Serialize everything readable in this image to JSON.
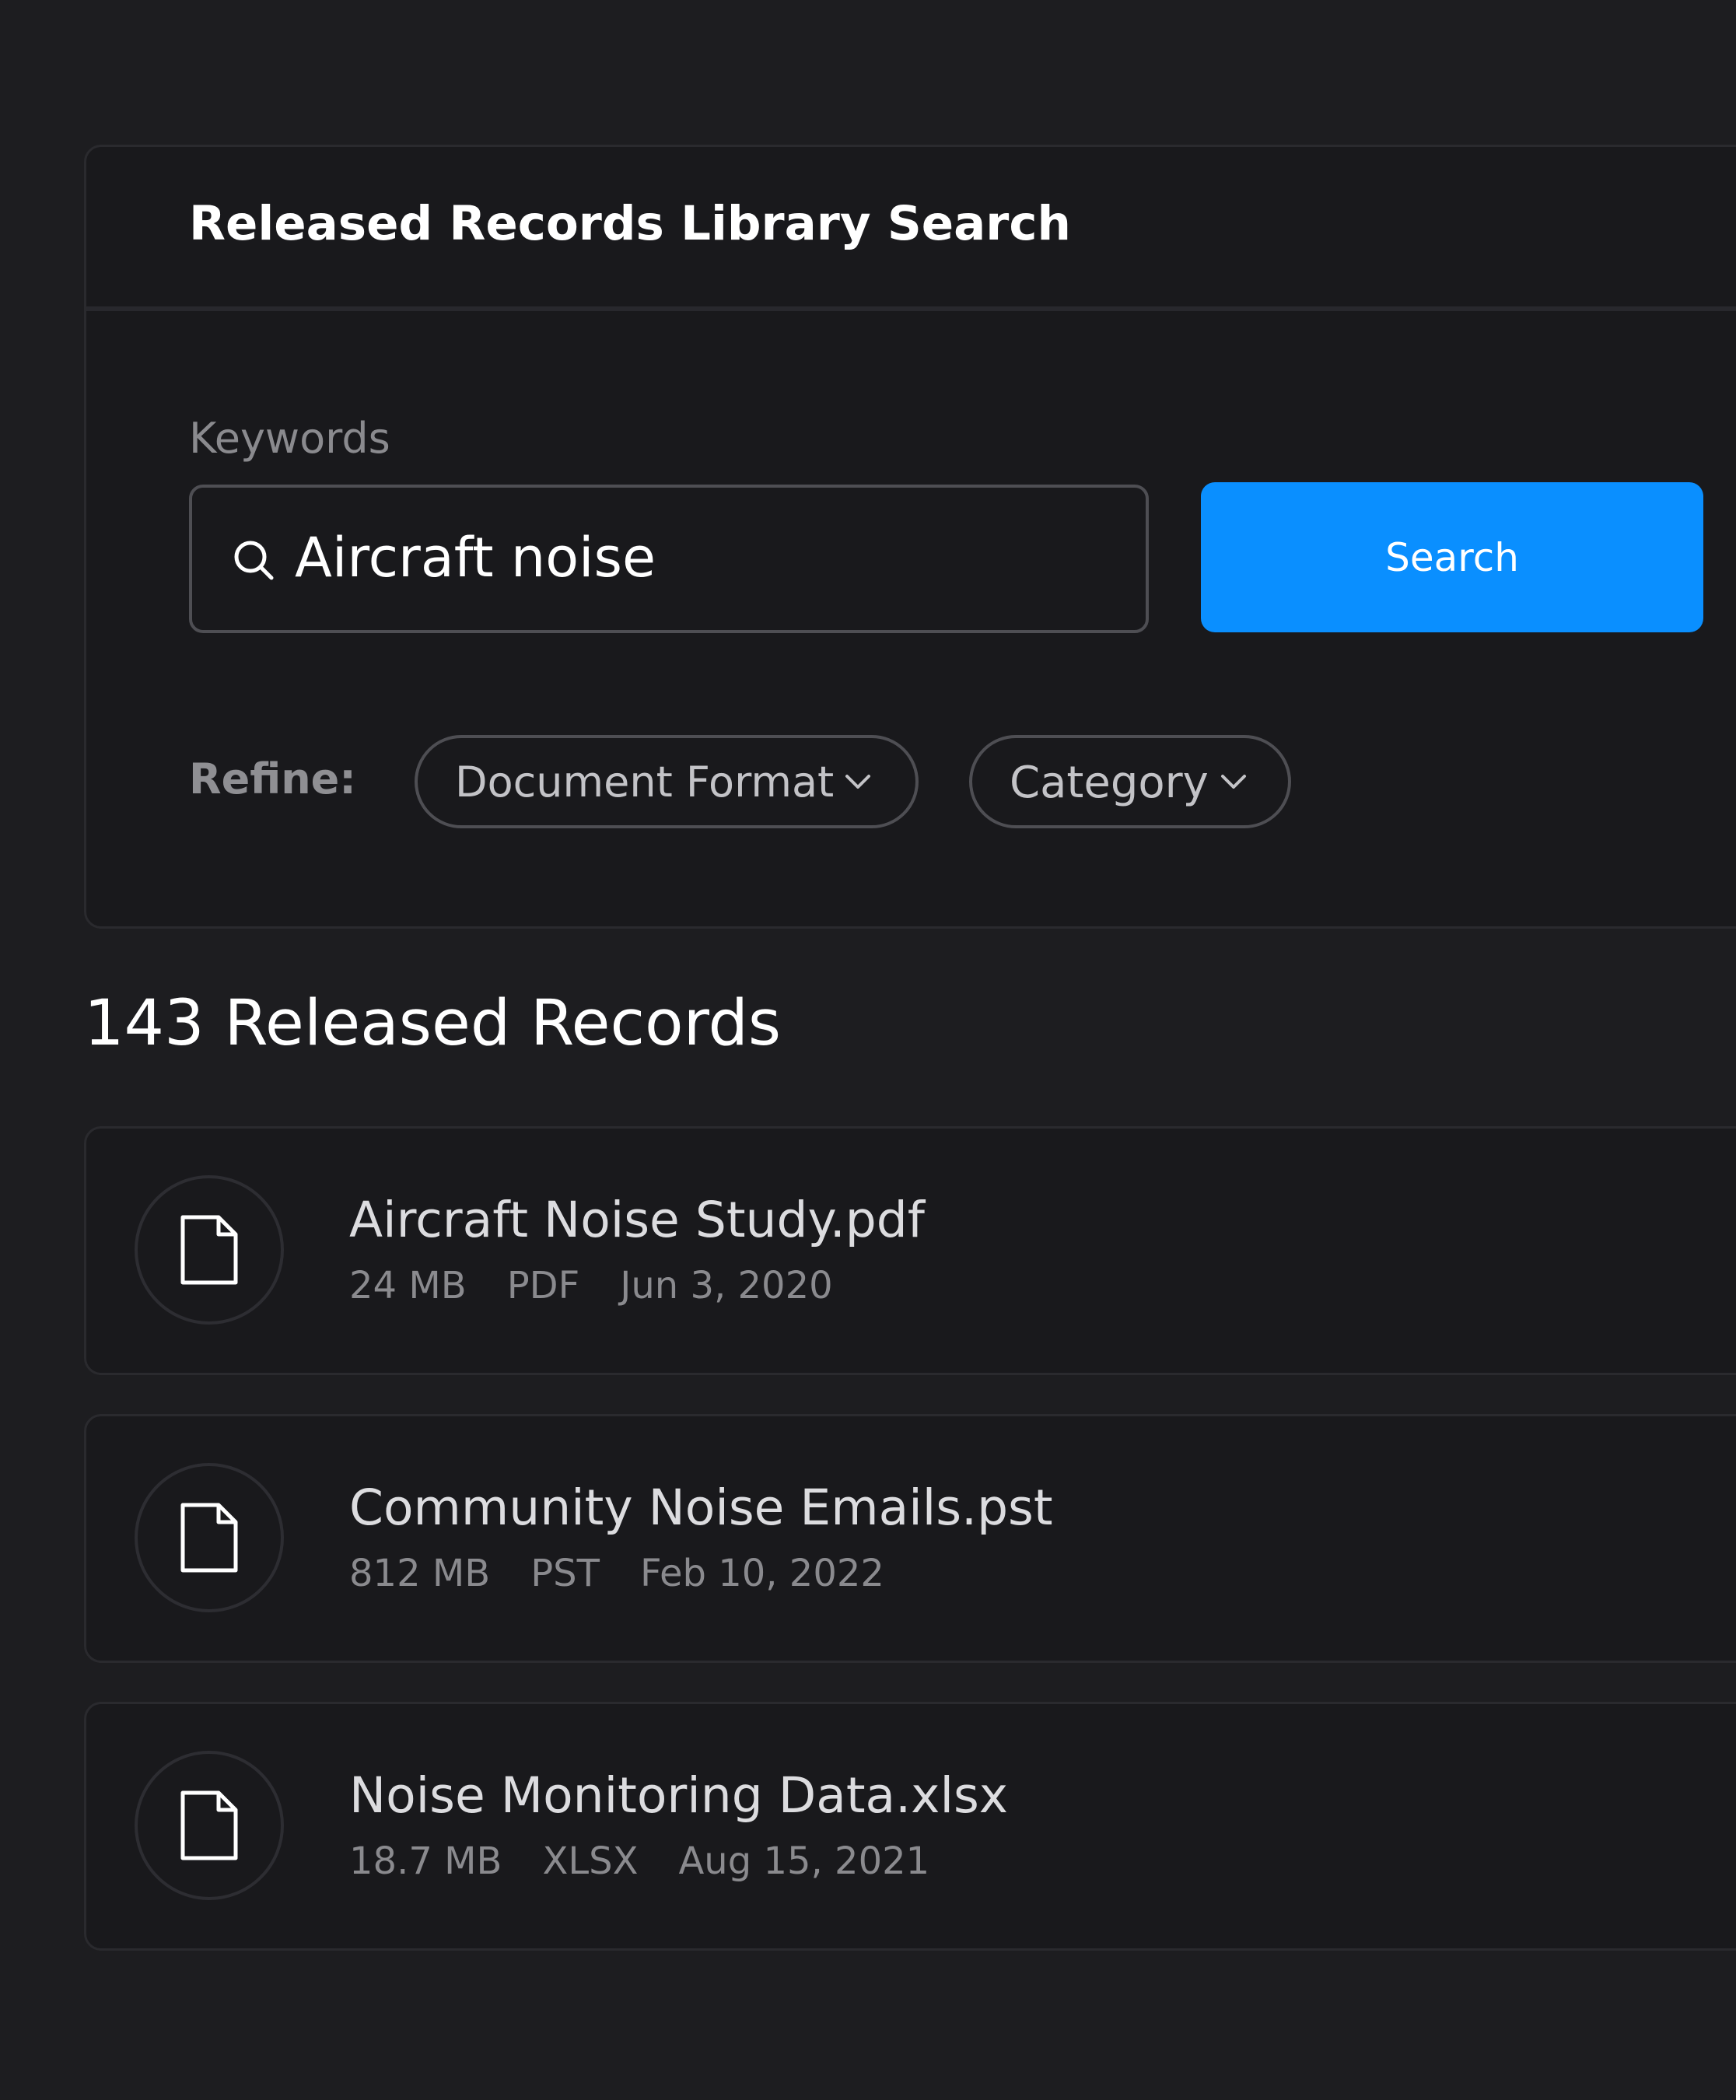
{
  "panel": {
    "title": "Released Records Library Search",
    "keywords_label": "Keywords",
    "search_value": "Aircraft noise",
    "search_button": "Search",
    "refine_label": "Refine:",
    "filters": [
      {
        "label": "Document Format"
      },
      {
        "label": "Category"
      }
    ]
  },
  "results": {
    "heading": "143 Released Records",
    "records": [
      {
        "name": "Aircraft Noise Study.pdf",
        "size": "24 MB",
        "format": "PDF",
        "date": "Jun 3, 2020"
      },
      {
        "name": "Community Noise Emails.pst",
        "size": "812 MB",
        "format": "PST",
        "date": "Feb 10, 2022"
      },
      {
        "name": "Noise Monitoring Data.xlsx",
        "size": "18.7 MB",
        "format": "XLSX",
        "date": "Aug 15, 2021"
      }
    ]
  },
  "icons": {
    "search": "search-icon",
    "chevron": "chevron-down-icon",
    "file": "file-icon"
  },
  "colors": {
    "background": "#1d1d20",
    "panel": "#19191c",
    "accent": "#0a8fff",
    "text_primary": "#ffffff",
    "text_secondary": "#8a8a8e"
  }
}
